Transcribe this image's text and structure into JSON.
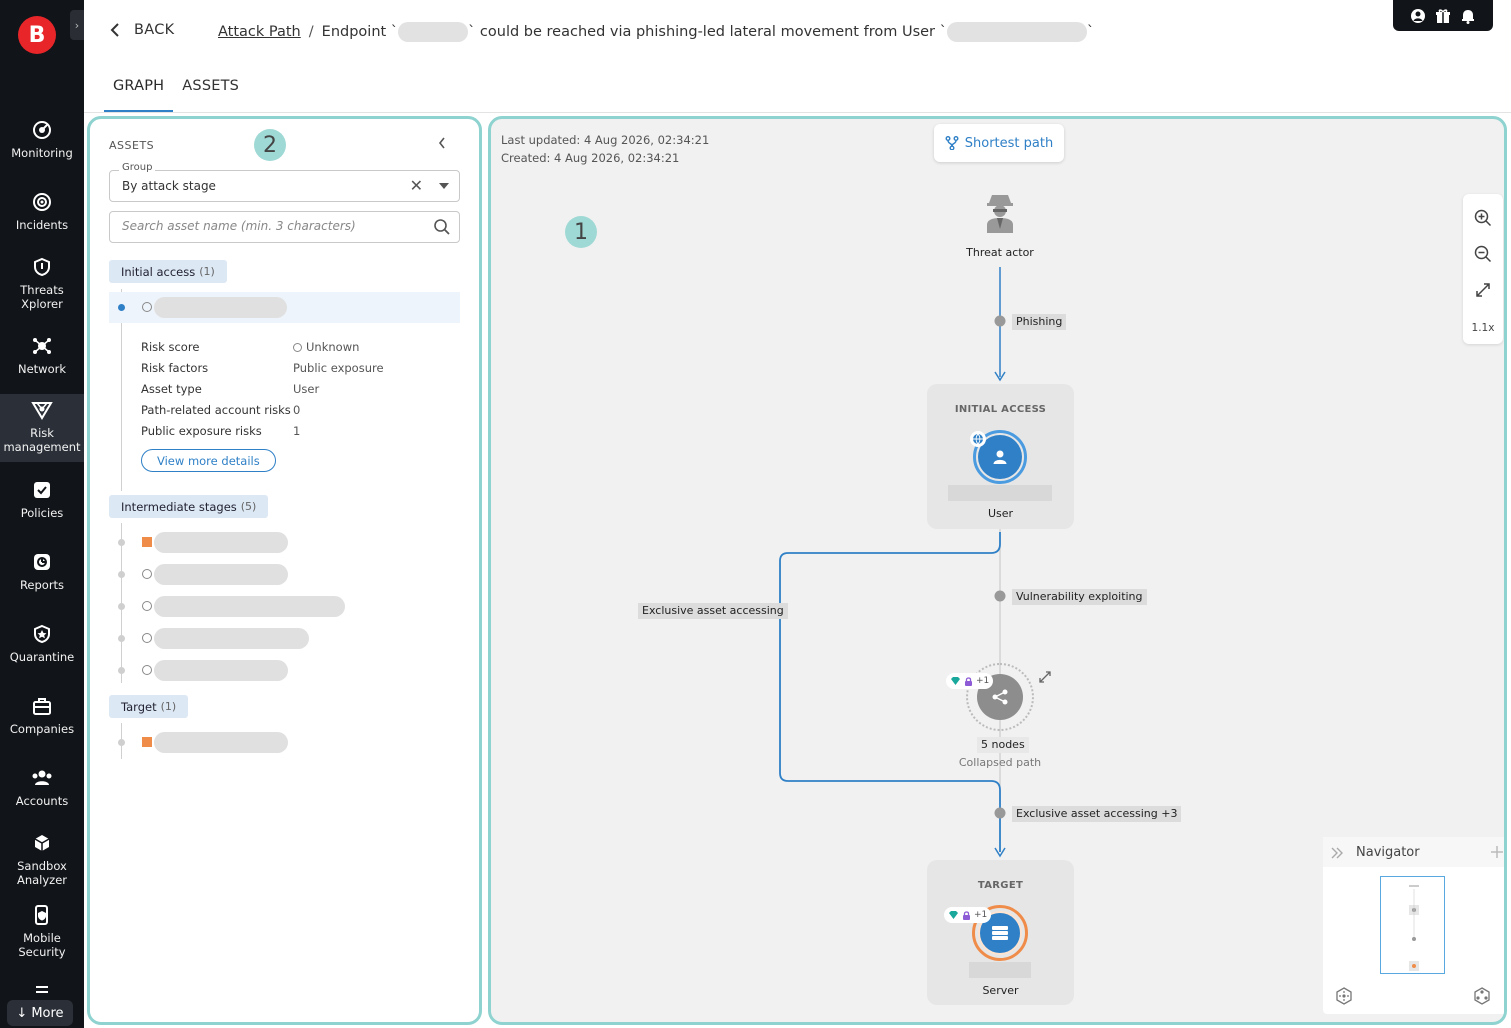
{
  "app": {
    "logo_letter": "B",
    "nav_items": [
      {
        "label": "Monitoring",
        "icon": "monitoring-icon"
      },
      {
        "label": "Incidents",
        "icon": "incidents-icon"
      },
      {
        "label": "Threats Xplorer",
        "icon": "shield-icon"
      },
      {
        "label": "Network",
        "icon": "network-icon"
      },
      {
        "label": "Risk management",
        "icon": "risk-management-icon",
        "active": true
      },
      {
        "label": "Policies",
        "icon": "policies-icon"
      },
      {
        "label": "Reports",
        "icon": "reports-icon"
      },
      {
        "label": "Quarantine",
        "icon": "quarantine-icon"
      },
      {
        "label": "Companies",
        "icon": "companies-icon"
      },
      {
        "label": "Accounts",
        "icon": "accounts-icon"
      },
      {
        "label": "Sandbox Analyzer",
        "icon": "sandbox-icon"
      },
      {
        "label": "Mobile Security",
        "icon": "mobile-security-icon"
      }
    ],
    "more_label": "More"
  },
  "header": {
    "back_label": "BACK",
    "breadcrumb_link": "Attack Path",
    "breadcrumb_sep": "/",
    "title_part1": "Endpoint `",
    "title_part2": "` could be reached via phishing-led lateral movement from User `",
    "title_part3": "`",
    "top_icons": [
      "user-icon",
      "gift-icon",
      "bell-icon"
    ]
  },
  "tabs": [
    {
      "label": "GRAPH",
      "active": true
    },
    {
      "label": "ASSETS",
      "active": false
    }
  ],
  "assets_panel": {
    "title": "ASSETS",
    "annotation": "2",
    "group_legend": "Group",
    "group_value": "By attack stage",
    "search_placeholder": "Search asset name (min. 3 characters)",
    "stages": [
      {
        "label": "Initial access",
        "count": "(1)"
      },
      {
        "label": "Intermediate stages",
        "count": "(5)"
      },
      {
        "label": "Target",
        "count": "(1)"
      }
    ],
    "details": [
      {
        "key": "Risk score",
        "value": "Unknown"
      },
      {
        "key": "Risk factors",
        "value": "Public exposure"
      },
      {
        "key": "Asset type",
        "value": "User"
      },
      {
        "key": "Path-related account risks",
        "value": "0"
      },
      {
        "key": "Public exposure risks",
        "value": "1"
      }
    ],
    "view_more": "View more details"
  },
  "graph": {
    "annotation": "1",
    "last_updated": "Last updated: 4 Aug 2026, 02:34:21",
    "created": "Created: 4 Aug 2026, 02:34:21",
    "shortest_path": "Shortest path",
    "zoom_level": "1.1x",
    "threat_actor": "Threat actor",
    "edge_phishing": "Phishing",
    "initial_access_label": "INITIAL ACCESS",
    "user_label": "User",
    "edge_vuln": "Vulnerability exploiting",
    "edge_exclusive": "Exclusive asset accessing",
    "collapsed_badge": "+1",
    "collapsed_nodes": "5 nodes",
    "collapsed_path": "Collapsed path",
    "edge_exclusive_plus": "Exclusive asset accessing +3",
    "target_label": "TARGET",
    "target_badge": "+1",
    "server_label": "Server",
    "navigator_title": "Navigator",
    "colors": {
      "accent": "#2f80c7",
      "highlight": "#8fd3d0",
      "target_ring": "#f08c4a"
    }
  }
}
